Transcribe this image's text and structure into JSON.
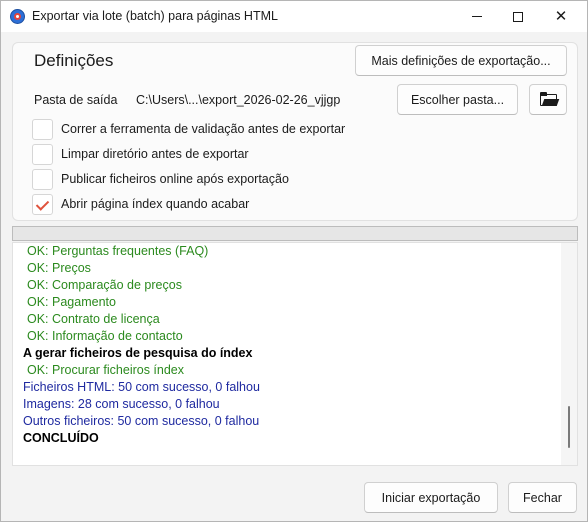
{
  "window": {
    "title": "Exportar via lote (batch) para páginas HTML",
    "icon": "app-logo-icon"
  },
  "settings": {
    "title": "Definições",
    "more_button": "Mais definições de exportação...",
    "output_label": "Pasta de saída",
    "output_path": "C:\\Users\\...\\export_2026-02-26_vjjgp",
    "choose_button": "Escolher pasta...",
    "folder_icon": "folder-open-icon",
    "options": [
      {
        "label": "Correr a ferramenta de validação antes de exportar",
        "checked": false
      },
      {
        "label": "Limpar diretório antes de exportar",
        "checked": false
      },
      {
        "label": "Publicar ficheiros online após exportação",
        "checked": false
      },
      {
        "label": "Abrir página índex quando acabar",
        "checked": true
      }
    ]
  },
  "progress": {
    "value": 0
  },
  "log": [
    {
      "type": "ok",
      "text": "OK: Perguntas frequentes (FAQ)"
    },
    {
      "type": "ok",
      "text": "OK: Preços"
    },
    {
      "type": "ok",
      "text": "OK: Comparação de preços"
    },
    {
      "type": "ok",
      "text": "OK: Pagamento"
    },
    {
      "type": "ok",
      "text": "OK: Contrato de licença"
    },
    {
      "type": "ok",
      "text": "OK: Informação de contacto"
    },
    {
      "type": "head",
      "text": "A gerar ficheiros de pesquisa do índex"
    },
    {
      "type": "ok",
      "text": "OK: Procurar ficheiros índex"
    },
    {
      "type": "info",
      "text": "Ficheiros HTML:  50 com sucesso, 0 falhou"
    },
    {
      "type": "info",
      "text": "Imagens:  28 com sucesso, 0 falhou"
    },
    {
      "type": "info",
      "text": "Outros ficheiros:  50 com sucesso, 0 falhou"
    },
    {
      "type": "head",
      "text": "CONCLUÍDO"
    }
  ],
  "footer": {
    "start_button": "Iniciar exportação",
    "close_button": "Fechar"
  },
  "colors": {
    "ok": "#2b8a1e",
    "info": "#1f2aa0",
    "check_accent": "#e0533d"
  }
}
